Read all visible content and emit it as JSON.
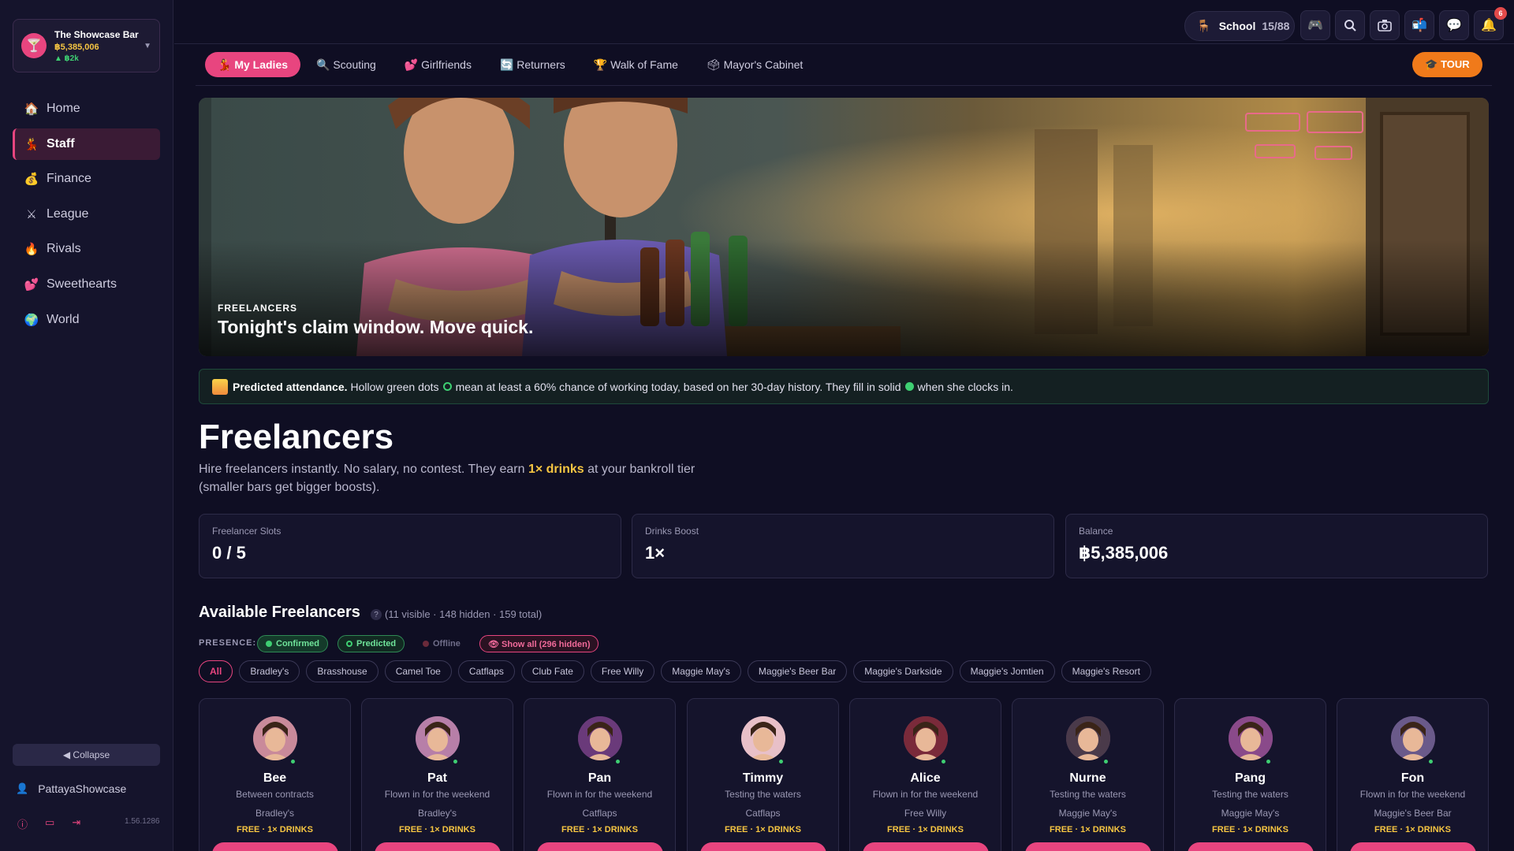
{
  "venue": {
    "name": "The Showcase Bar",
    "balance": "฿5,385,006",
    "gain": "▲ ฿2k",
    "logo_icon": "cocktail-icon"
  },
  "sidebar": {
    "items": [
      {
        "label": "Home",
        "icon": "house-icon",
        "glyph": "🏠"
      },
      {
        "label": "Staff",
        "icon": "dancer-icon",
        "glyph": "💃",
        "active": true
      },
      {
        "label": "Finance",
        "icon": "money-bag-icon",
        "glyph": "💰"
      },
      {
        "label": "League",
        "icon": "crossed-swords-icon",
        "glyph": "⚔"
      },
      {
        "label": "Rivals",
        "icon": "fire-icon",
        "glyph": "🔥"
      },
      {
        "label": "Sweethearts",
        "icon": "hearts-icon",
        "glyph": "💕"
      },
      {
        "label": "World",
        "icon": "globe-icon",
        "glyph": "🌍"
      }
    ],
    "collapse_label": "◀ Collapse",
    "username": "PattayaShowcase",
    "version": "1.56.1286"
  },
  "topbar": {
    "school_label": "School",
    "school_count": "15/88",
    "notification_count": "6"
  },
  "tabs": [
    {
      "label": "💃 My Ladies",
      "active": true
    },
    {
      "label": "🔍 Scouting"
    },
    {
      "label": "💕 Girlfriends"
    },
    {
      "label": "🔄 Returners"
    },
    {
      "label": "🏆 Walk of Fame"
    },
    {
      "label": "🗳 Mayor's Cabinet"
    }
  ],
  "tour_label": "🎓 TOUR",
  "hero": {
    "kicker": "FREELANCERS",
    "title": "Tonight's claim window. Move quick."
  },
  "notice": {
    "bold": "Predicted attendance.",
    "text1": "Hollow green dots",
    "text2": "mean at least a 60% chance of working today, based on her 30-day history. They fill in solid",
    "text3": "when she clocks in."
  },
  "page": {
    "title": "Freelancers",
    "subtitle_pre": "Hire freelancers instantly. No salary, no contest. They earn ",
    "subtitle_hl": "1× drinks",
    "subtitle_post": " at your bankroll tier (smaller bars get bigger boosts)."
  },
  "stats": [
    {
      "label": "Freelancer Slots",
      "value": "0 / 5"
    },
    {
      "label": "Drinks Boost",
      "value": "1×"
    },
    {
      "label": "Balance",
      "value": "฿5,385,006"
    }
  ],
  "available": {
    "title": "Available Freelancers",
    "count": "(11 visible · 148 hidden · 159 total)"
  },
  "presence": {
    "label": "PRESENCE:",
    "confirmed": "Confirmed",
    "predicted": "Predicted",
    "offline": "Offline",
    "show_all": "👁 Show all (296 hidden)"
  },
  "bar_filters": [
    "All",
    "Bradley's",
    "Brasshouse",
    "Camel Toe",
    "Catflaps",
    "Club Fate",
    "Free Willy",
    "Maggie May's",
    "Maggie's Beer Bar",
    "Maggie's Darkside",
    "Maggie's Jomtien",
    "Maggie's Resort"
  ],
  "freelancers": [
    {
      "name": "Bee",
      "status": "Between contracts",
      "bar": "Bradley's",
      "price": "FREE · 1× DRINKS",
      "avatar_color": "#c98a9a"
    },
    {
      "name": "Pat",
      "status": "Flown in for the weekend",
      "bar": "Bradley's",
      "price": "FREE · 1× DRINKS",
      "avatar_color": "#b77fa8"
    },
    {
      "name": "Pan",
      "status": "Flown in for the weekend",
      "bar": "Catflaps",
      "price": "FREE · 1× DRINKS",
      "avatar_color": "#6a3a7a"
    },
    {
      "name": "Timmy",
      "status": "Testing the waters",
      "bar": "Catflaps",
      "price": "FREE · 1× DRINKS",
      "avatar_color": "#e8c0c8"
    },
    {
      "name": "Alice",
      "status": "Flown in for the weekend",
      "bar": "Free Willy",
      "price": "FREE · 1× DRINKS",
      "avatar_color": "#7a2a3a"
    },
    {
      "name": "Nurne",
      "status": "Testing the waters",
      "bar": "Maggie May's",
      "price": "FREE · 1× DRINKS",
      "avatar_color": "#4a3a4a"
    },
    {
      "name": "Pang",
      "status": "Testing the waters",
      "bar": "Maggie May's",
      "price": "FREE · 1× DRINKS",
      "avatar_color": "#8a4a8a"
    },
    {
      "name": "Fon",
      "status": "Flown in for the weekend",
      "bar": "Maggie's Beer Bar",
      "price": "FREE · 1× DRINKS",
      "avatar_color": "#6a5a8a"
    }
  ],
  "colors": {
    "accent": "#e8457f",
    "gold": "#f5c542",
    "online": "#3ecf72",
    "tour": "#f07a1a"
  }
}
